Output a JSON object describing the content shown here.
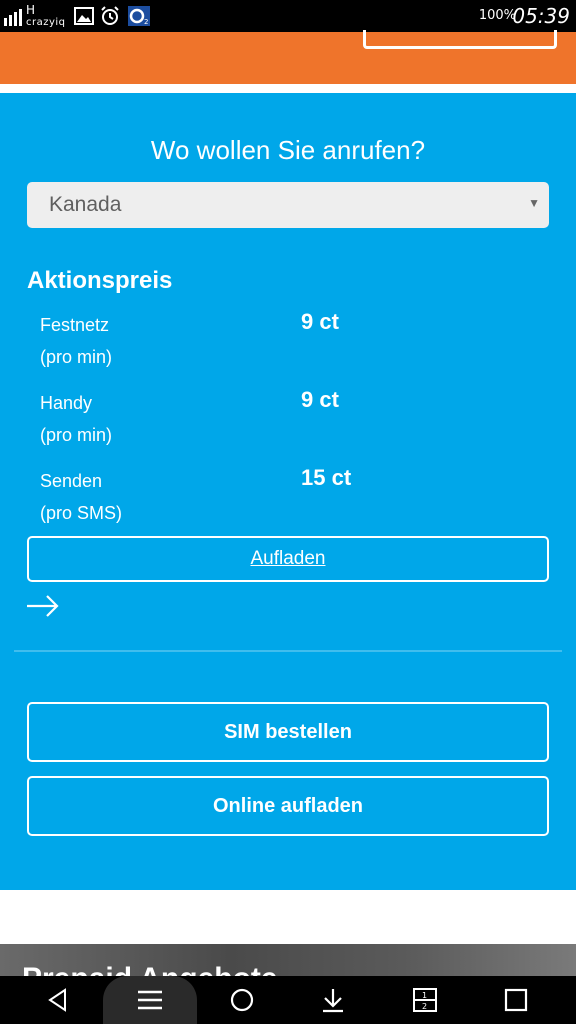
{
  "status_bar": {
    "network": "H",
    "carrier": "crazyiq",
    "battery": "100%",
    "time": "05:39",
    "icons": [
      "gallery-icon",
      "alarm-icon",
      "o2-icon"
    ]
  },
  "calling": {
    "question": "Wo wollen Sie anrufen?",
    "country_select": {
      "selected": "Kanada"
    },
    "section_title": "Aktionspreis",
    "rates": [
      {
        "label": "Festnetz",
        "unit": "(pro min)",
        "price": "9 ct"
      },
      {
        "label": "Handy",
        "unit": "(pro min)",
        "price": "9 ct"
      },
      {
        "label": "Senden",
        "unit": "(pro SMS)",
        "price": "15 ct"
      }
    ],
    "topup_link": "Aufladen"
  },
  "actions": {
    "sim_order": "SIM bestellen",
    "online_topup": "Online aufladen"
  },
  "banner": {
    "partial_text": "Prepaid Angebote"
  },
  "colors": {
    "orange": "#ef742b",
    "blue": "#00a7e9",
    "white": "#ffffff",
    "black": "#000000"
  },
  "nav_bar": {
    "icons": [
      "back-icon",
      "menu-icon",
      "home-icon",
      "download-icon",
      "split-screen-icon",
      "recent-apps-icon"
    ]
  }
}
